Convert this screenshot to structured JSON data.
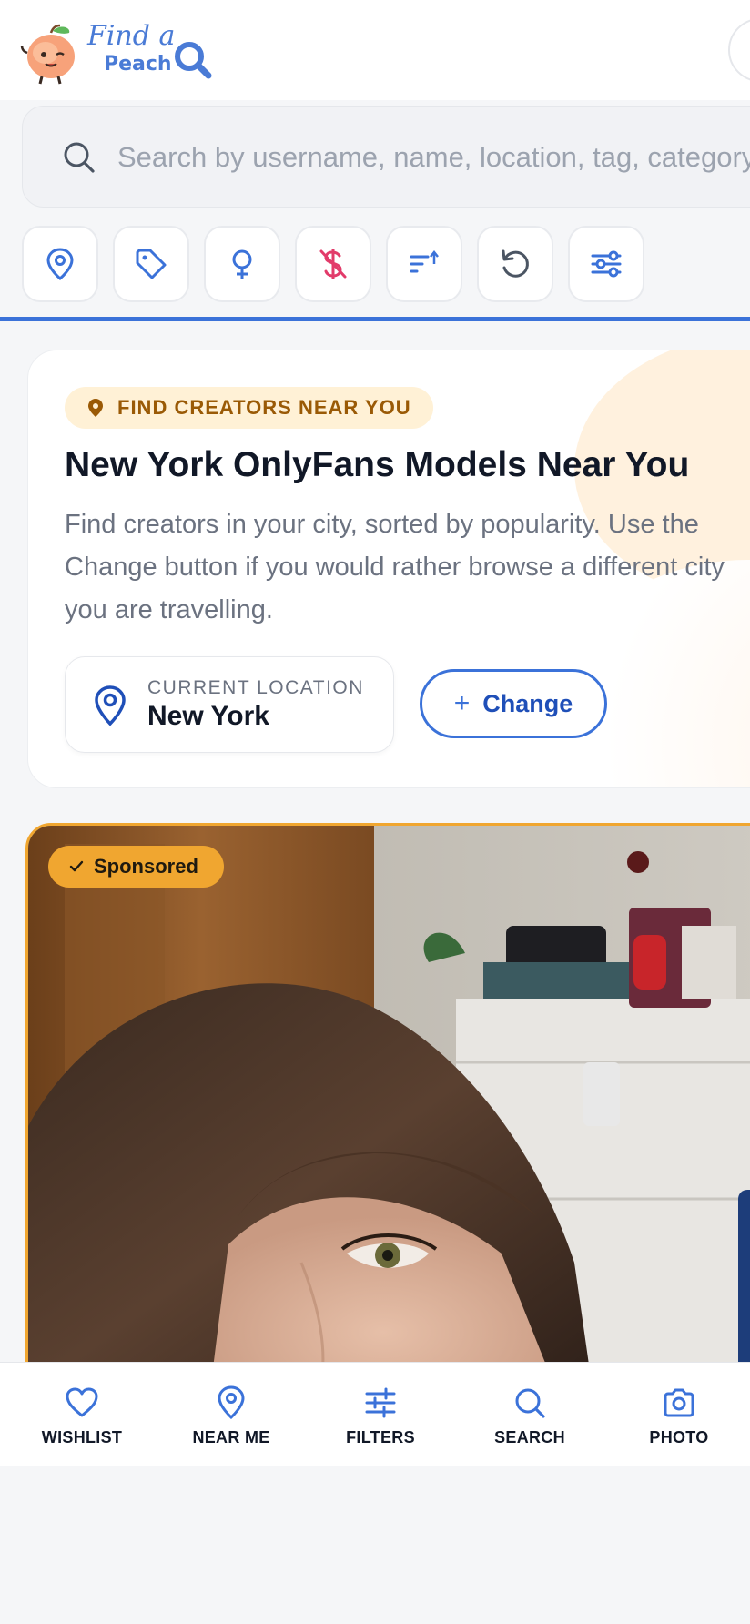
{
  "header": {
    "logo_line1": "Find a",
    "logo_line2": "Peach",
    "logo_icon": "peach-mascot-icon"
  },
  "search": {
    "placeholder": "Search by username, name, location, tag, category..."
  },
  "filters": [
    {
      "icon": "location-pin-icon",
      "color": "#3b72d9"
    },
    {
      "icon": "tag-icon",
      "color": "#3b72d9"
    },
    {
      "icon": "female-gender-icon",
      "color": "#3b72d9"
    },
    {
      "icon": "no-dollar-icon",
      "color": "#e23b6a"
    },
    {
      "icon": "sort-icon",
      "color": "#3b72d9"
    },
    {
      "icon": "reset-icon",
      "color": "#4b5563"
    },
    {
      "icon": "sliders-icon",
      "color": "#3b72d9"
    }
  ],
  "location_card": {
    "badge": "FIND CREATORS NEAR YOU",
    "title": "New York OnlyFans Models Near You",
    "description_lines": [
      "Find creators in your city, sorted by popularity. Use the",
      "Change button if you would rather browse a different city",
      "you are travelling."
    ],
    "current_label": "CURRENT LOCATION",
    "current_value": "New York",
    "change_plus": "+",
    "change_label": "Change"
  },
  "sponsored": {
    "badge": "Sponsored"
  },
  "bottom_nav": [
    {
      "label": "WISHLIST",
      "icon": "heart-icon"
    },
    {
      "label": "NEAR ME",
      "icon": "location-pin-icon"
    },
    {
      "label": "FILTERS",
      "icon": "sliders-icon"
    },
    {
      "label": "SEARCH",
      "icon": "search-icon"
    },
    {
      "label": "PHOTO",
      "icon": "camera-icon"
    }
  ],
  "colors": {
    "accent": "#3b72d9",
    "sponsor": "#f0a630",
    "badge_bg": "#fff1d6",
    "badge_text": "#9a5a06"
  }
}
